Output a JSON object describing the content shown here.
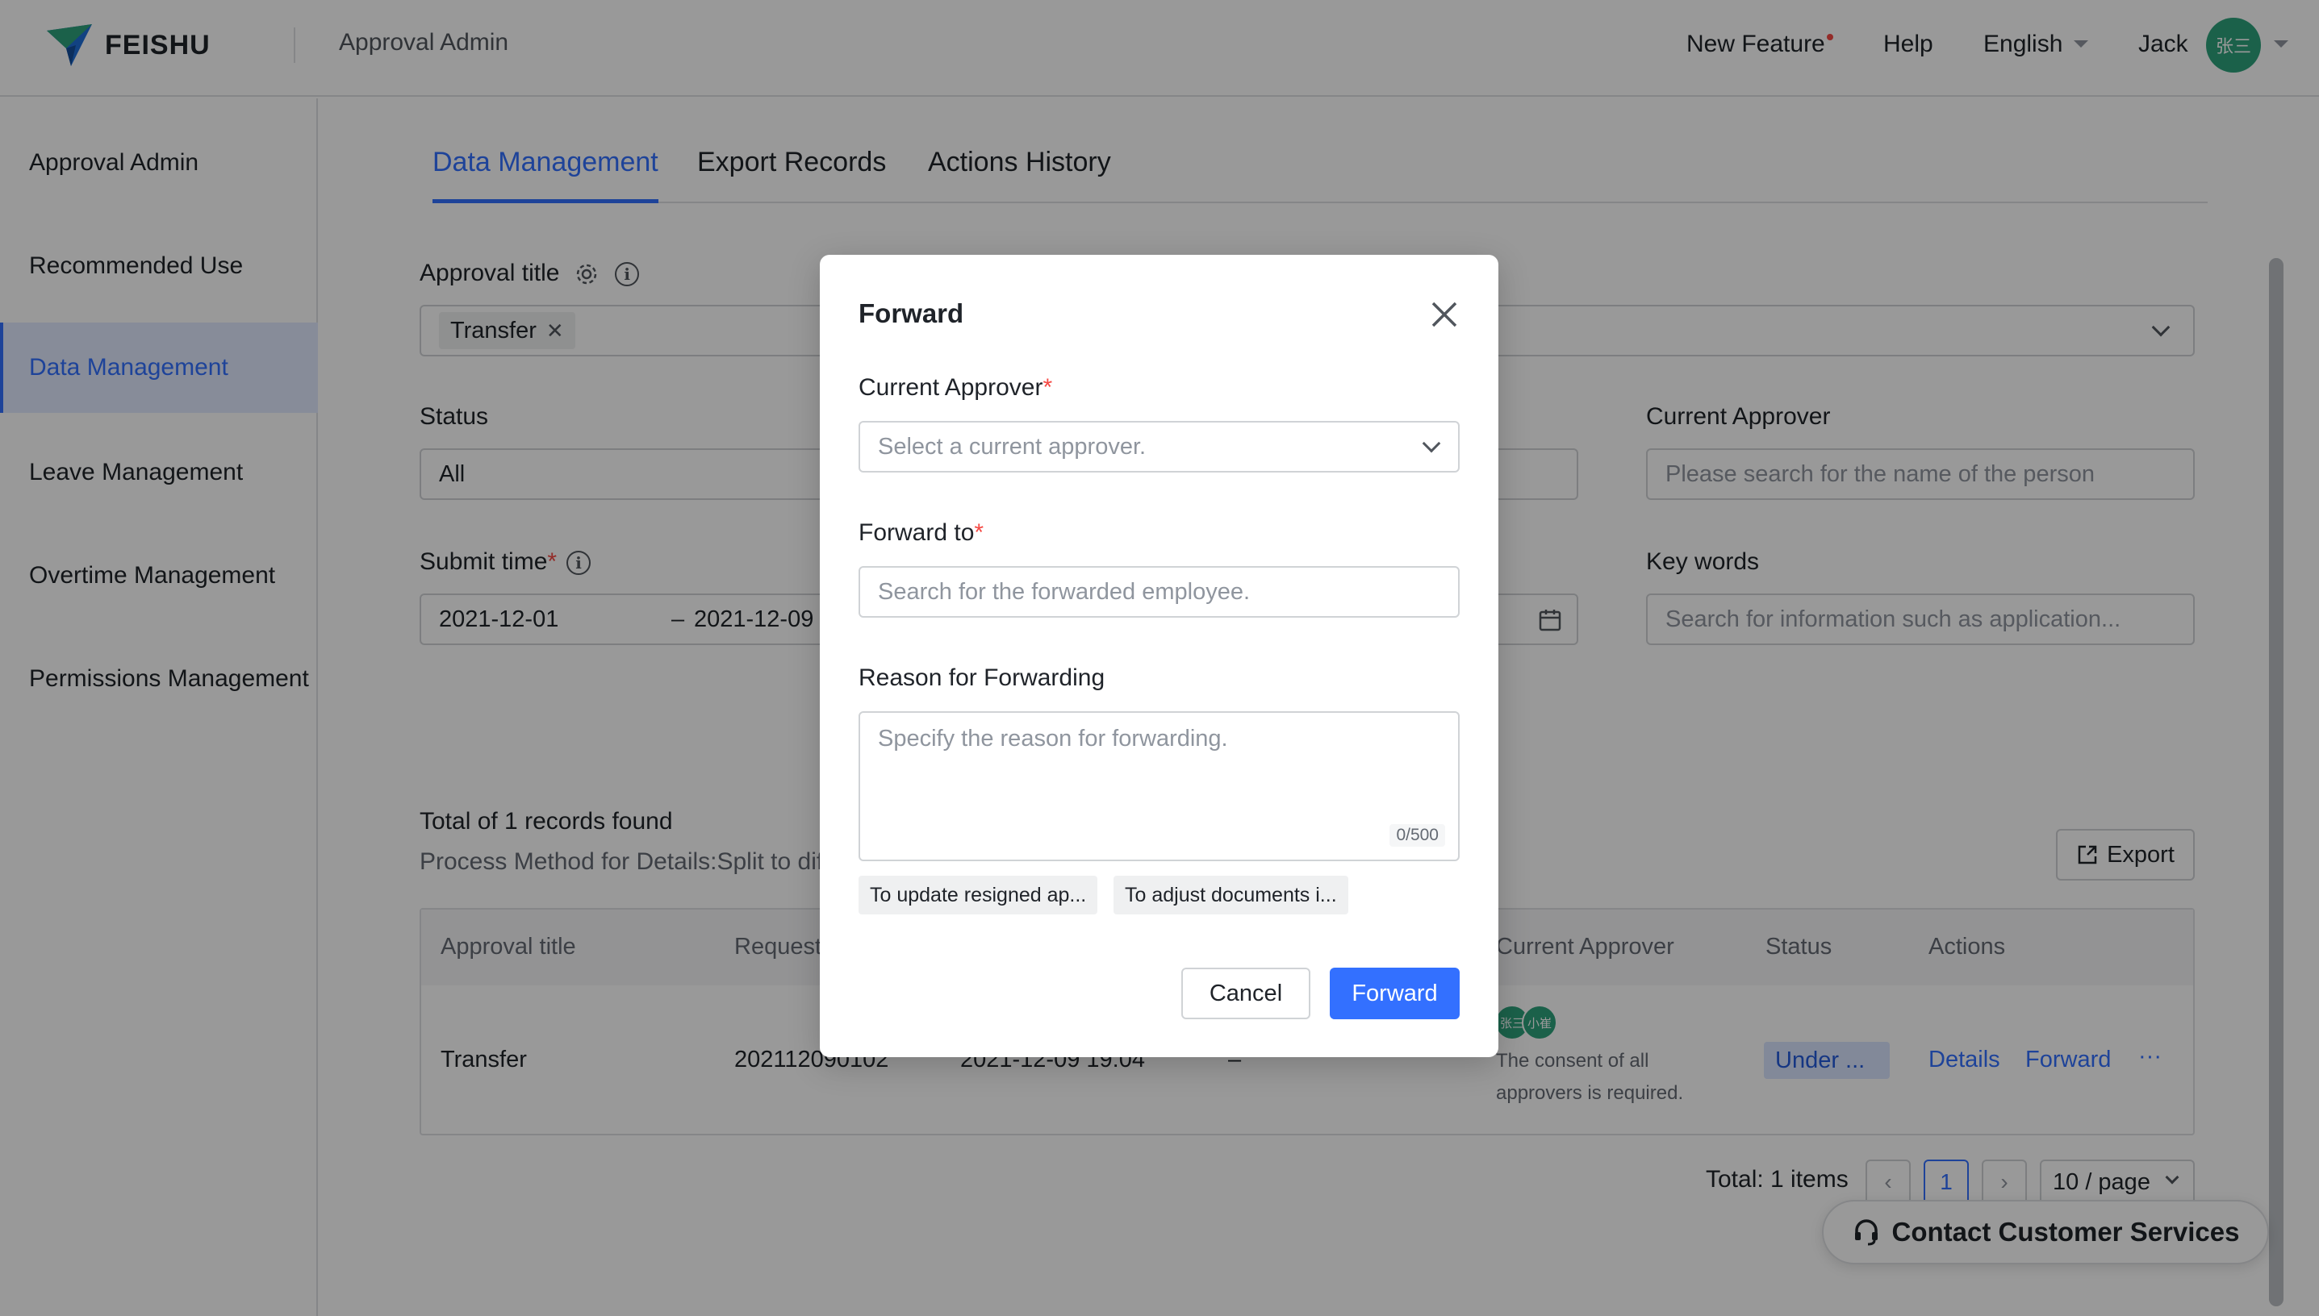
{
  "header": {
    "brand": "FEISHU",
    "title": "Approval Admin",
    "new_feature": "New Feature",
    "help": "Help",
    "language": "English",
    "user_name": "Jack",
    "avatar_text": "张三"
  },
  "sidebar": {
    "items": [
      {
        "label": "Approval Admin"
      },
      {
        "label": "Recommended Use"
      },
      {
        "label": "Data Management"
      },
      {
        "label": "Leave Management"
      },
      {
        "label": "Overtime Management"
      },
      {
        "label": "Permissions Management"
      }
    ]
  },
  "tabs": [
    {
      "label": "Data Management"
    },
    {
      "label": "Export Records"
    },
    {
      "label": "Actions History"
    }
  ],
  "filters": {
    "approval_title_label": "Approval title",
    "approval_title_tag": "Transfer",
    "status_label": "Status",
    "status_value": "All",
    "current_approver_label": "Current Approver",
    "current_approver_placeholder": "Please search for the name of the person",
    "submit_time_label": "Submit time",
    "submit_start": "2021-12-01",
    "date_separator": "–",
    "submit_end": "2021-12-09",
    "keywords_label": "Key words",
    "keywords_placeholder": "Search for information such as application..."
  },
  "results": {
    "total_text": "Total of 1 records found",
    "process_method": "Process Method for Details:Split to dif",
    "export_label": "Export"
  },
  "table": {
    "headers": [
      "Approval title",
      "Request",
      "Current Approver",
      "Status",
      "Actions"
    ],
    "row": {
      "title": "Transfer",
      "request_id": "202112090102",
      "submit_time": "2021-12-09 19:04",
      "initiator": "–",
      "approver_avatars": [
        "张三",
        "小崔"
      ],
      "approver_note_1": "The consent of all",
      "approver_note_2": "approvers is required.",
      "status": "Under ...",
      "action_details": "Details",
      "action_forward": "Forward",
      "action_more": "···"
    }
  },
  "pagination": {
    "total": "Total: 1 items",
    "prev": "‹",
    "current": "1",
    "next": "›",
    "page_size": "10 / page"
  },
  "contact": {
    "label": "Contact Customer Services"
  },
  "modal": {
    "title": "Forward",
    "current_approver_label": "Current Approver",
    "required_mark": "*",
    "current_approver_placeholder": "Select a current approver.",
    "forward_to_label": "Forward to",
    "forward_to_placeholder": "Search for the forwarded employee.",
    "reason_label": "Reason for Forwarding",
    "reason_placeholder": "Specify the reason for forwarding.",
    "counter": "0/500",
    "chips": [
      "To update resigned ap...",
      "To adjust documents i..."
    ],
    "cancel": "Cancel",
    "forward": "Forward"
  },
  "colors": {
    "accent": "#3370ff",
    "required": "#f54a45",
    "avatar": "#2ea27c"
  }
}
